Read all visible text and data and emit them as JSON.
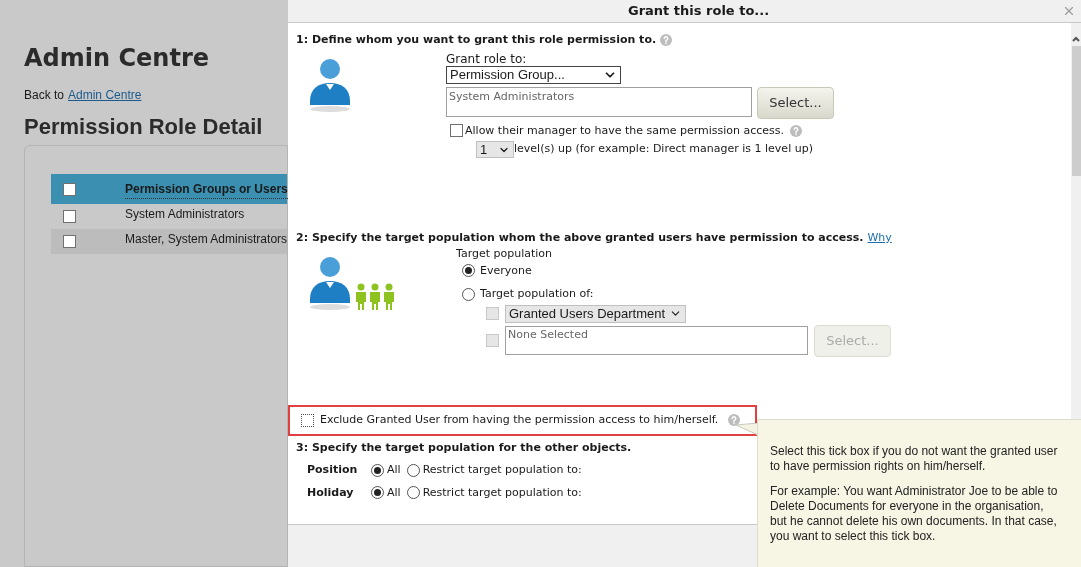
{
  "page": {
    "title": "Admin Centre",
    "back_text": "Back to",
    "back_link": "Admin Centre",
    "heading": "Permission Role Detail",
    "table": {
      "header_checked": false,
      "column": "Permission Groups or Users",
      "rows": [
        {
          "name": "System Administrators",
          "checked": false
        },
        {
          "name": "Master, System Administrators",
          "checked": false
        }
      ]
    }
  },
  "dialog": {
    "title": "Grant this role to...",
    "section_1": {
      "heading": "1: Define whom you want to grant this role permission to.",
      "grant_label": "Grant role to:",
      "grant_select": "Permission Group...",
      "field_value": "System Administrators",
      "select_button": "Select...",
      "manager_checkbox": {
        "label": "Allow their manager to have the same permission access.",
        "checked": false
      },
      "level_select": "1",
      "level_text": "level(s) up (for example: Direct manager is 1 level up)"
    },
    "section_2": {
      "heading": "2: Specify the target population whom the above granted users have permission to access.",
      "link": "Why",
      "label": "Target population",
      "radios": [
        {
          "label": "Everyone",
          "selected": true
        },
        {
          "label": "Target population of:",
          "selected": false
        }
      ],
      "department": {
        "checked": false,
        "disabled": true,
        "select": "Granted Users Department"
      },
      "selection": {
        "checked": false,
        "disabled": true,
        "field_value": "None Selected",
        "button": "Select..."
      }
    },
    "exclude": {
      "label": "Exclude Granted User from having the permission access to him/herself.",
      "checked": false,
      "highlighted": true
    },
    "section_3": {
      "heading": "3: Specify the target population for the other objects.",
      "rows": [
        {
          "name": "Position",
          "options": [
            {
              "label": "All",
              "selected": true
            },
            {
              "label": "Restrict target population to:",
              "selected": false
            }
          ]
        },
        {
          "name": "Holiday",
          "options": [
            {
              "label": "All",
              "selected": true
            },
            {
              "label": "Restrict target population to:",
              "selected": false
            }
          ]
        }
      ]
    }
  },
  "tooltip": {
    "paragraphs": [
      "Select this tick box if you do not want the granted user to have permission rights on him/herself.",
      "For example: You want Administrator Joe to be able to Delete Documents for everyone in the organisation, but he cannot delete his own documents. In that case, you want to select this tick box."
    ]
  }
}
